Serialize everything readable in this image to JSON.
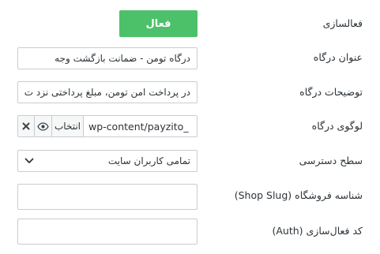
{
  "fields": {
    "activation": {
      "label": "فعالسازی",
      "toggle_label": "فعال"
    },
    "gateway_title": {
      "label": "عنوان درگاه",
      "value": "درگاه تومن - ضمانت بازگشت وجه"
    },
    "gateway_description": {
      "label": "توضیحات درگاه",
      "value": "در پرداخت امن تومن، مبلغ پرداختی نزد ت"
    },
    "gateway_logo": {
      "label": "لوگوی درگاه",
      "path": "wp-content/payzito_",
      "select_label": "انتخاب",
      "view_icon": "eye-icon",
      "remove_icon": "close-icon"
    },
    "access_level": {
      "label": "سطح دسترسی",
      "selected": "تمامی کاربران سایت"
    },
    "shop_slug": {
      "label": "شناسه فروشگاه (Shop Slug)",
      "value": ""
    },
    "auth_code": {
      "label": "کد فعال‌سازی (Auth)",
      "value": ""
    }
  },
  "colors": {
    "toggle_active": "#4cc16a",
    "border": "#c9ccd0"
  }
}
